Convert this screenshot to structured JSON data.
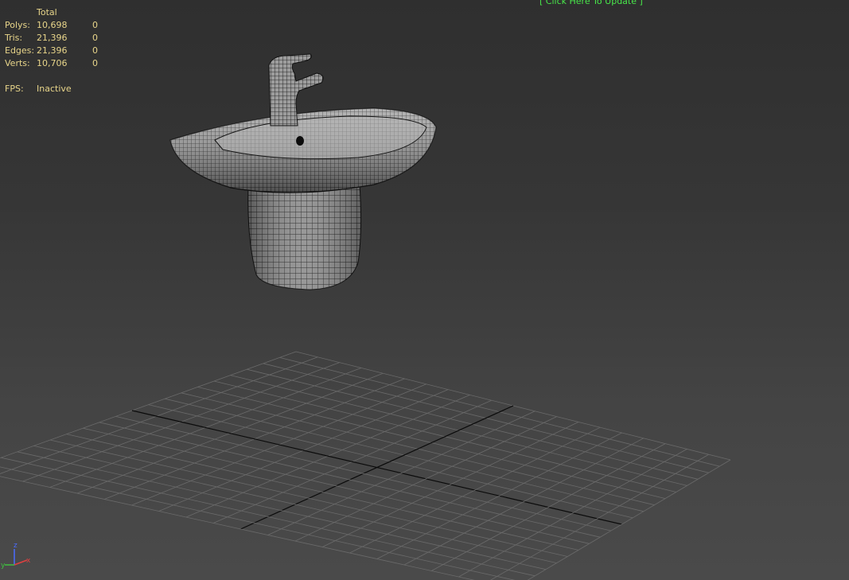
{
  "stats": {
    "header": "Total",
    "rows": [
      {
        "label": "Polys:",
        "total": "10,698",
        "selected": "0"
      },
      {
        "label": "Tris:",
        "total": "21,396",
        "selected": "0"
      },
      {
        "label": "Edges:",
        "total": "21,396",
        "selected": "0"
      },
      {
        "label": "Verts:",
        "total": "10,706",
        "selected": "0"
      }
    ],
    "fps_label": "FPS:",
    "fps_value": "Inactive"
  },
  "update_link": "[ Click Here To Update ]",
  "axis": {
    "x": "x",
    "y": "y",
    "z": "z"
  },
  "colors": {
    "stats_text": "#e8d58a",
    "update_link": "#48e84a",
    "grid": "#6a6a6a",
    "axis_z": "#4a6cff",
    "axis_x": "#e04040",
    "axis_y": "#40c040"
  }
}
